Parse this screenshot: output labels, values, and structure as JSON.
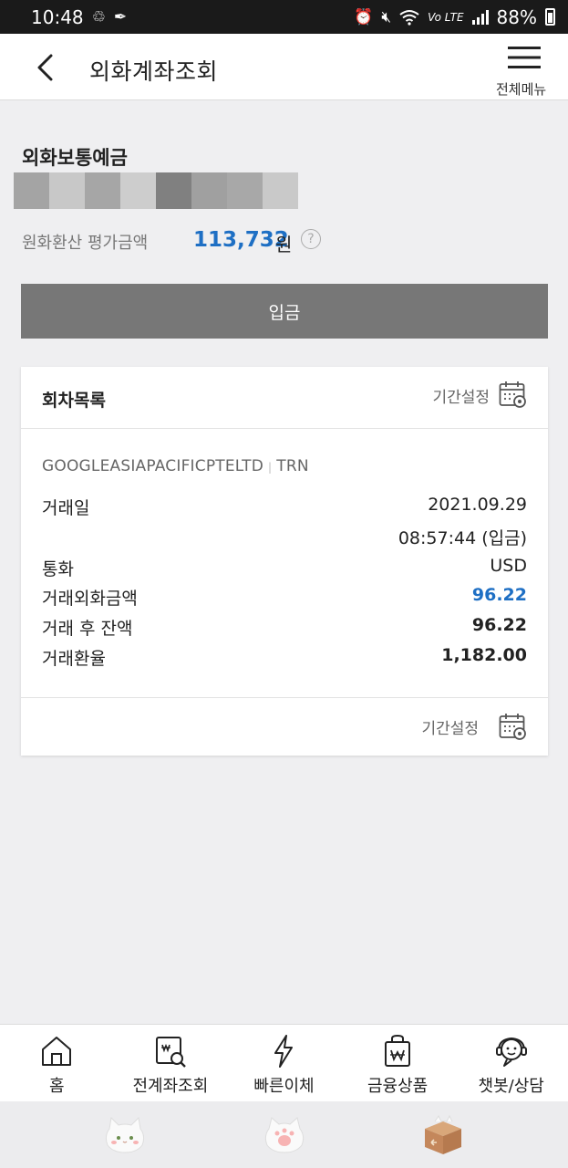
{
  "status_bar": {
    "time": "10:48",
    "battery": "88%",
    "network_tag": "Vo LTE"
  },
  "header": {
    "title": "외화계좌조회",
    "menu_label": "전체메뉴"
  },
  "account": {
    "type": "외화보통예금",
    "eval_label": "원화환산 평가금액",
    "eval_amount": "113,732",
    "eval_unit": "원",
    "help_glyph": "?"
  },
  "deposit_button": "입금",
  "history": {
    "title": "회차목록",
    "period_label": "기간설정",
    "transaction": {
      "counterparty": "GOOGLEASIAPACIFICPTELTD",
      "separator": "|",
      "kind": "TRN",
      "date_label": "거래일",
      "date": "2021.09.29",
      "time": "08:57:44 (입금)",
      "currency_label": "통화",
      "currency": "USD",
      "fx_amount_label": "거래외화금액",
      "fx_amount": "96.22",
      "balance_label": "거래 후 잔액",
      "balance": "96.22",
      "rate_label": "거래환율",
      "rate": "1,182.00"
    },
    "footer_period_label": "기간설정"
  },
  "bottom_nav": [
    {
      "label": "홈",
      "icon": "home-icon"
    },
    {
      "label": "전계좌조회",
      "icon": "account-search-icon"
    },
    {
      "label": "빠른이체",
      "icon": "lightning-icon"
    },
    {
      "label": "금융상품",
      "icon": "shopping-bag-icon"
    },
    {
      "label": "챗봇/상담",
      "icon": "chatbot-icon"
    }
  ],
  "colors": {
    "accent_blue": "#1e6fc4",
    "button_gray": "#777777",
    "background": "#efeff1"
  }
}
